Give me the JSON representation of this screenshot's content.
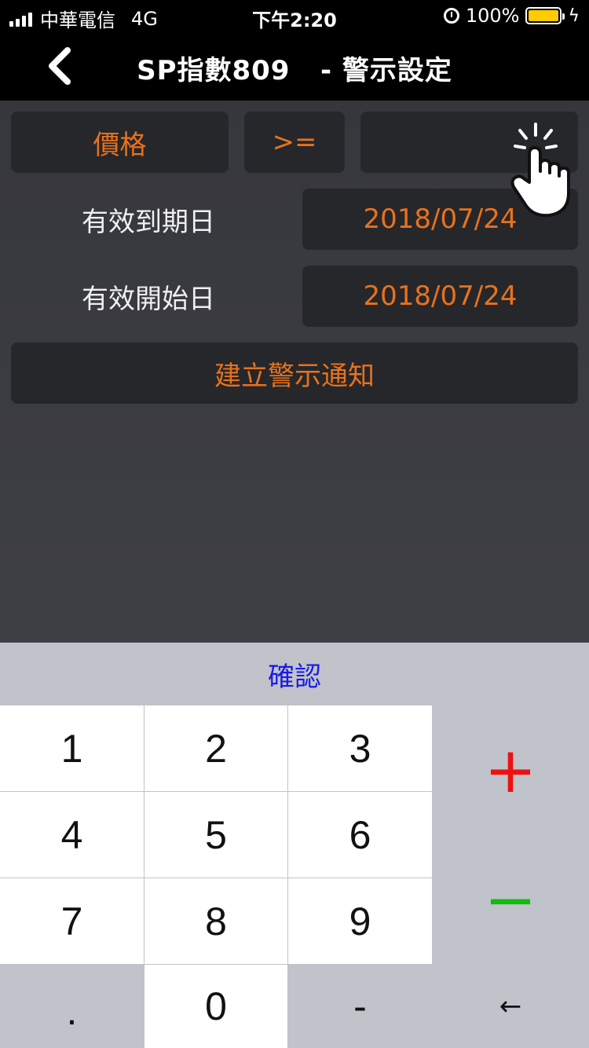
{
  "status": {
    "carrier": "中華電信",
    "network": "4G",
    "time": "下午2:20",
    "battery": "100%",
    "battery_color": "#ffcc00"
  },
  "nav": {
    "title": "SP指數809   - 警示設定",
    "back_icon": "chevron-left-icon"
  },
  "form": {
    "field_label": "價格",
    "operator": ">=",
    "price_value": "",
    "expiry_label": "有效到期日",
    "expiry_value": "2018/07/24",
    "start_label": "有效開始日",
    "start_value": "2018/07/24",
    "create_button": "建立警示通知",
    "accent_color": "#e8721c"
  },
  "keypad": {
    "confirm": "確認",
    "keys": [
      "1",
      "2",
      "3",
      "4",
      "5",
      "6",
      "7",
      "8",
      "9",
      ".",
      "0",
      "-"
    ],
    "plus": "+",
    "minus": "−",
    "backspace": "←",
    "plus_color": "#ee1111",
    "minus_color": "#11bb11"
  }
}
